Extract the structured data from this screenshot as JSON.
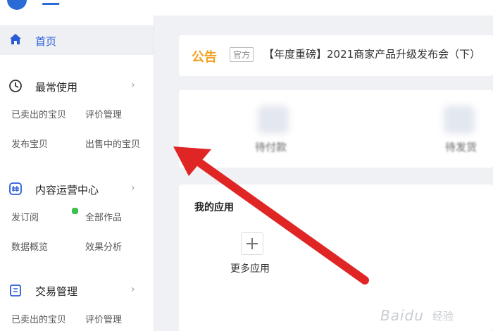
{
  "sidebar": {
    "home": {
      "label": "首页"
    },
    "sections": [
      {
        "title": "最常使用",
        "items": [
          "已卖出的宝贝",
          "评价管理",
          "发布宝贝",
          "出售中的宝贝"
        ]
      },
      {
        "title": "内容运营中心",
        "items": [
          "发订阅",
          "全部作品",
          "数据概览",
          "效果分析"
        ]
      },
      {
        "title": "交易管理",
        "items": [
          "已卖出的宝贝",
          "评价管理"
        ]
      }
    ]
  },
  "notice": {
    "title": "公告",
    "tag": "官方",
    "text": "【年度重磅】2021商家产品升级发布会（下）"
  },
  "stats": {
    "items": [
      {
        "label": "待付款"
      },
      {
        "label": "待发货"
      }
    ]
  },
  "apps": {
    "title": "我的应用",
    "more_label": "更多应用"
  },
  "watermark": {
    "text": "Baidu",
    "sub": "经验"
  },
  "colors": {
    "accent": "#2a5bd7",
    "notice": "#f0a020",
    "arrow": "#e02525",
    "green": "#3cc34d"
  }
}
